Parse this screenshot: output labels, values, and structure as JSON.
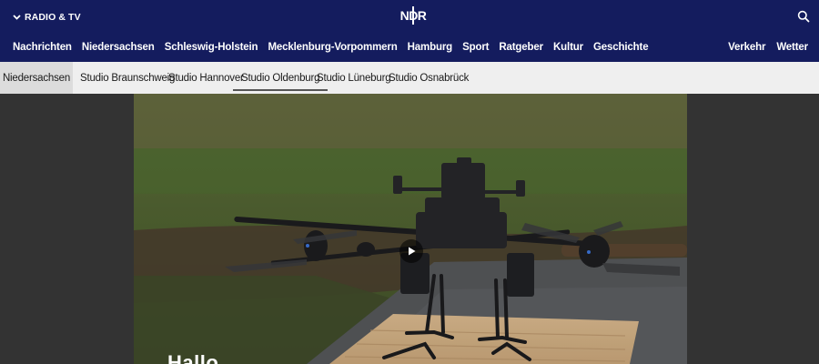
{
  "header": {
    "radio_tv_label": "RADIO & TV",
    "logo_text": "NDR",
    "main_nav": [
      {
        "label": "Nachrichten"
      },
      {
        "label": "Niedersachsen"
      },
      {
        "label": "Schleswig-Holstein"
      },
      {
        "label": "Mecklenburg-Vorpommern"
      },
      {
        "label": "Hamburg"
      },
      {
        "label": "Sport"
      },
      {
        "label": "Ratgeber"
      },
      {
        "label": "Kultur"
      },
      {
        "label": "Geschichte"
      }
    ],
    "right_nav": [
      {
        "label": "Verkehr"
      },
      {
        "label": "Wetter"
      }
    ],
    "colors": {
      "header_bg": "#141c5e",
      "subnav_bg": "#efefef"
    }
  },
  "subnav": {
    "items": [
      {
        "label": "Niedersachsen"
      },
      {
        "label": "Studio Braunschweig"
      },
      {
        "label": "Studio Hannover"
      },
      {
        "label": "Studio Oldenburg",
        "active": true
      },
      {
        "label": "Studio Lüneburg"
      },
      {
        "label": "Studio Osnabrück"
      }
    ]
  },
  "video": {
    "caption": "Hallo",
    "icons": {
      "play": "play-icon"
    }
  }
}
